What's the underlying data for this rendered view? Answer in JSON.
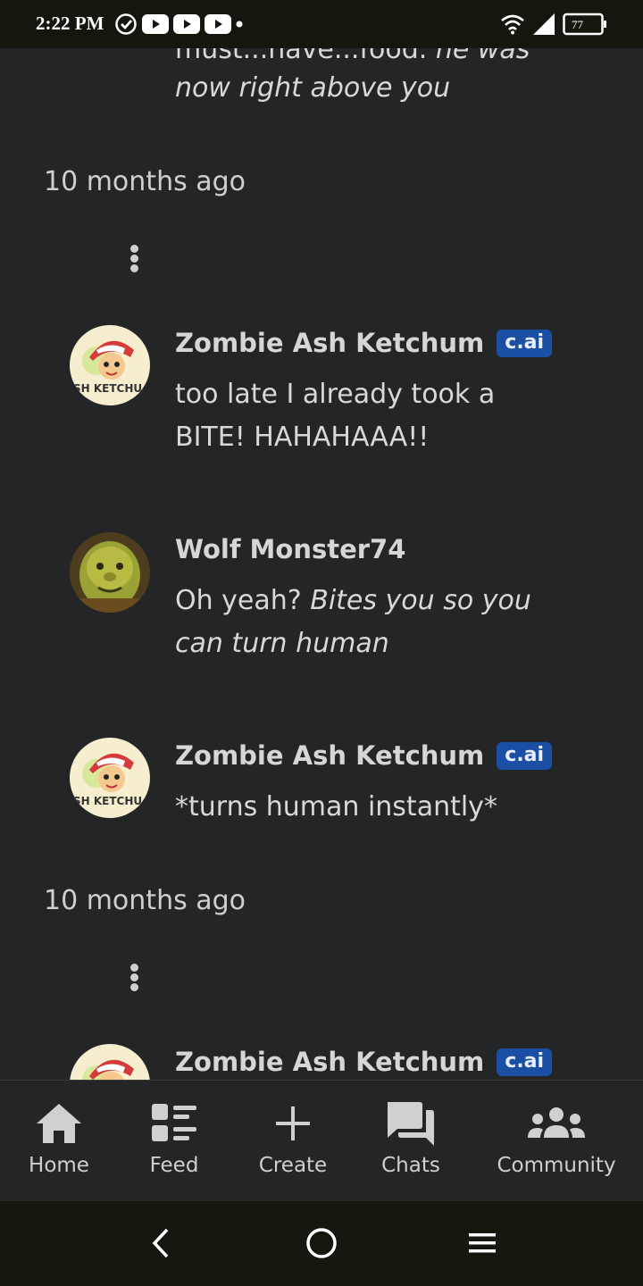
{
  "status_bar": {
    "time": "2:22 PM",
    "battery": "77"
  },
  "messages": [
    {
      "partial_top_text": "must...have...food.",
      "partial_top_italic": "he was",
      "italic_line": "now right above you"
    }
  ],
  "timestamps": [
    "10 months ago",
    "10 months ago"
  ],
  "thread": [
    {
      "sender": "Zombie Ash Ketchum",
      "badge": "c.ai",
      "text": "too late I already took a BITE! HAHAHAAA!!"
    },
    {
      "sender": "Wolf Monster74",
      "text_plain": "Oh yeah?",
      "text_italic": "Bites you so you can turn human"
    },
    {
      "sender": "Zombie Ash Ketchum",
      "badge": "c.ai",
      "text": "*turns human instantly*"
    },
    {
      "sender": "Zombie Ash Ketchum",
      "badge": "c.ai"
    }
  ],
  "avatar_caption": "SH KETCHU",
  "bottom_nav": [
    {
      "label": "Home",
      "icon": "home-icon"
    },
    {
      "label": "Feed",
      "icon": "feed-icon"
    },
    {
      "label": "Create",
      "icon": "plus-icon"
    },
    {
      "label": "Chats",
      "icon": "chats-icon"
    },
    {
      "label": "Community",
      "icon": "community-icon"
    }
  ],
  "colors": {
    "background": "#242526",
    "badge": "#1b4fa3",
    "system_bar": "#16160f"
  }
}
